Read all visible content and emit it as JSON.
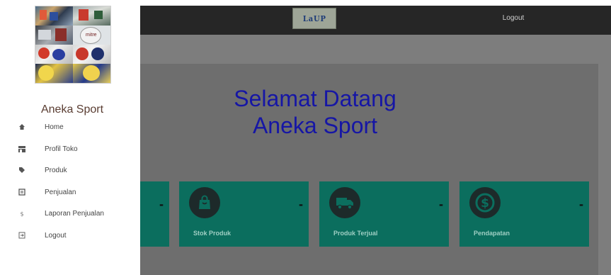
{
  "header": {
    "logo_text": "LaUP",
    "logout_label": "Logout"
  },
  "sidebar": {
    "store_name": "Aneka Sport",
    "items": [
      {
        "label": "Home",
        "icon": "home-icon"
      },
      {
        "label": "Profil Toko",
        "icon": "store-icon"
      },
      {
        "label": "Produk",
        "icon": "tag-icon"
      },
      {
        "label": "Penjualan",
        "icon": "receipt-icon"
      },
      {
        "label": "Laporan Penjualan",
        "icon": "dollar-icon"
      },
      {
        "label": "Logout",
        "icon": "logout-icon"
      }
    ]
  },
  "main": {
    "welcome_line1": "Selamat Datang",
    "welcome_line2": "Aneka Sport",
    "cards": [
      {
        "label": "",
        "value": "-",
        "icon": "none"
      },
      {
        "label": "Stok Produk",
        "value": "-",
        "icon": "shopping-bag-icon"
      },
      {
        "label": "Produk Terjual",
        "value": "-",
        "icon": "truck-icon"
      },
      {
        "label": "Pendapatan",
        "value": "-",
        "icon": "dollar-circle-icon"
      }
    ]
  },
  "colors": {
    "topbar": "#262626",
    "card": "#0b6e5e",
    "welcome_text": "#1616a5",
    "overlay": "#7d7d7d"
  }
}
